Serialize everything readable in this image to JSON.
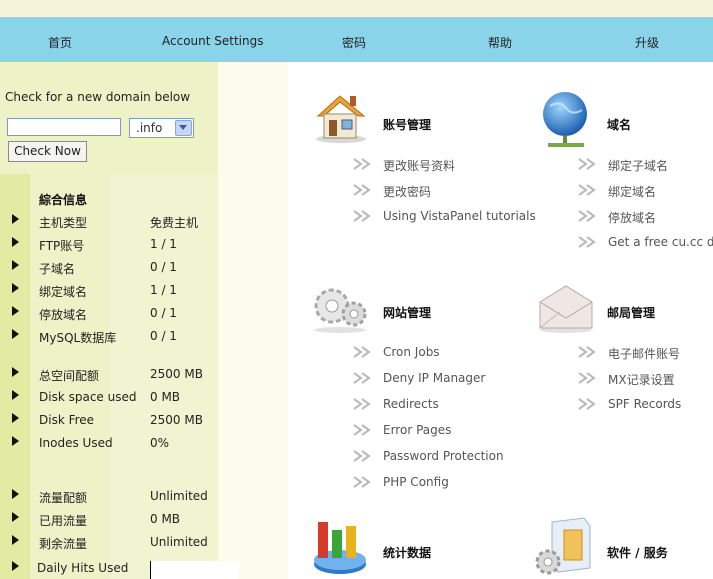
{
  "nav": [
    "首页",
    "Account Settings",
    "密码",
    "帮助",
    "升级"
  ],
  "domain_check": {
    "label": "Check for a new domain below",
    "input_value": "",
    "tld": ".info",
    "button": "Check Now"
  },
  "stats": {
    "title": "綜合信息",
    "rows": [
      {
        "label": "主机类型",
        "value": "免费主机"
      },
      {
        "label": "FTP账号",
        "value": "1 / 1"
      },
      {
        "label": "子域名",
        "value": "0 / 1"
      },
      {
        "label": "绑定域名",
        "value": "1 / 1"
      },
      {
        "label": "停放域名",
        "value": "0 / 1"
      },
      {
        "label": "MySQL数据库",
        "value": "0 / 1"
      },
      {
        "label": "总空间配额",
        "value": "2500 MB"
      },
      {
        "label": "Disk space used",
        "value": "0 MB"
      },
      {
        "label": "Disk Free",
        "value": "2500 MB"
      },
      {
        "label": "Inodes Used",
        "value": "0%"
      },
      {
        "label": "流量配额",
        "value": "Unlimited"
      },
      {
        "label": "已用流量",
        "value": "0 MB"
      },
      {
        "label": "剩余流量",
        "value": "Unlimited"
      }
    ],
    "daily_hits": "Daily Hits Used"
  },
  "sections": {
    "account": {
      "title": "账号管理",
      "links": [
        "更改账号资料",
        "更改密码",
        "Using VistaPanel tutorials"
      ]
    },
    "domain": {
      "title": "域名",
      "links": [
        "绑定子域名",
        "绑定域名",
        "停放域名",
        "Get a free cu.cc dor"
      ]
    },
    "site": {
      "title": "网站管理",
      "links": [
        "Cron Jobs",
        "Deny IP Manager",
        "Redirects",
        "Error Pages",
        "Password Protection",
        "PHP Config"
      ]
    },
    "mail": {
      "title": "邮局管理",
      "links": [
        "电子邮件账号",
        "MX记录设置",
        "SPF Records"
      ]
    },
    "statsec": {
      "title": "统计数据"
    },
    "software": {
      "title": "软件 / 服务"
    }
  }
}
